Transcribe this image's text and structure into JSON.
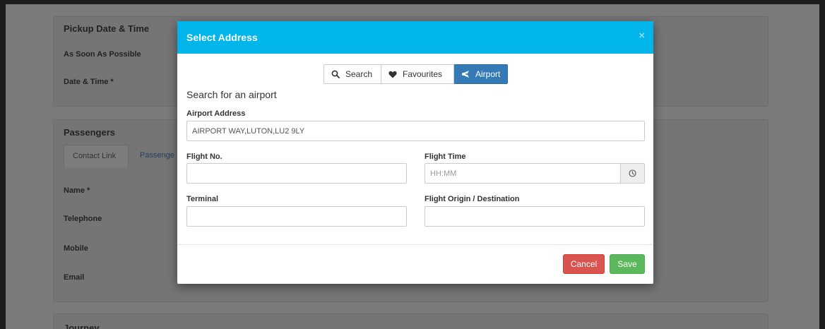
{
  "background": {
    "pickup_panel": {
      "heading": "Pickup Date & Time",
      "asap_label": "As Soon As Possible",
      "datetime_label": "Date & Time *"
    },
    "passengers_panel": {
      "heading": "Passengers",
      "tabs": [
        "Contact Link",
        "Passenge"
      ],
      "fields": [
        "Name *",
        "Telephone",
        "Mobile",
        "Email"
      ]
    },
    "journey_panel": {
      "heading": "Journey"
    }
  },
  "modal": {
    "title": "Select Address",
    "close_glyph": "×",
    "tabs": [
      {
        "label": "Search",
        "icon": "search-icon",
        "active": false
      },
      {
        "label": "Favourites",
        "icon": "heart-icon",
        "active": false
      },
      {
        "label": "Airport",
        "icon": "plane-icon",
        "active": true
      }
    ],
    "section_title": "Search for an airport",
    "airport_address": {
      "label": "Airport Address",
      "value": "AIRPORT WAY,LUTON,LU2 9LY"
    },
    "flight_no": {
      "label": "Flight No.",
      "value": ""
    },
    "flight_time": {
      "label": "Flight Time",
      "value": "",
      "placeholder": "HH:MM",
      "icon": "clock-icon"
    },
    "terminal": {
      "label": "Terminal",
      "value": ""
    },
    "flight_origin": {
      "label": "Flight Origin / Destination",
      "value": ""
    },
    "buttons": {
      "cancel": "Cancel",
      "save": "Save"
    }
  },
  "colors": {
    "header": "#00b5e9",
    "active_tab": "#337ab7",
    "cancel": "#d9534f",
    "save": "#5cb85c"
  }
}
